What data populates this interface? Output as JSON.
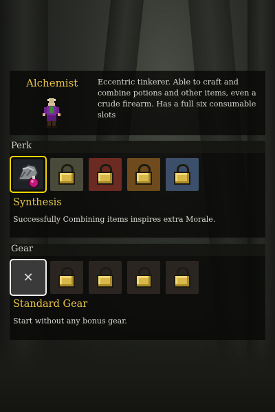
{
  "class": {
    "name": "Alchemist",
    "description": "Eccentric tinkerer. Able to craft and combine potions and other items, even a crude firearm. Has a full six consumable slots"
  },
  "perk": {
    "section_label": "Perk",
    "selected_name": "Synthesis",
    "selected_description": "Successfully Combining items inspires extra Morale.",
    "slots": [
      {
        "icon": "synthesis-perk-icon",
        "locked": false,
        "selected": true,
        "tint": "#6a6d70"
      },
      {
        "icon": "lock-icon",
        "locked": true,
        "selected": false,
        "tint": "#4a4a3a"
      },
      {
        "icon": "lock-icon",
        "locked": true,
        "selected": false,
        "tint": "#6b2a22"
      },
      {
        "icon": "lock-icon",
        "locked": true,
        "selected": false,
        "tint": "#6e4a1c"
      },
      {
        "icon": "lock-icon",
        "locked": true,
        "selected": false,
        "tint": "#3c4f6a"
      }
    ]
  },
  "gear": {
    "section_label": "Gear",
    "selected_name": "Standard Gear",
    "selected_description": "Start without any bonus gear.",
    "slots": [
      {
        "icon": "x-icon",
        "locked": false,
        "selected": true
      },
      {
        "icon": "lock-icon",
        "locked": true,
        "selected": false
      },
      {
        "icon": "lock-icon",
        "locked": true,
        "selected": false
      },
      {
        "icon": "lock-icon",
        "locked": true,
        "selected": false
      },
      {
        "icon": "lock-icon",
        "locked": true,
        "selected": false
      }
    ]
  },
  "colors": {
    "accent_gold": "#e6c54a",
    "selected_border": "#f2d800",
    "text": "#d8d6cf"
  }
}
